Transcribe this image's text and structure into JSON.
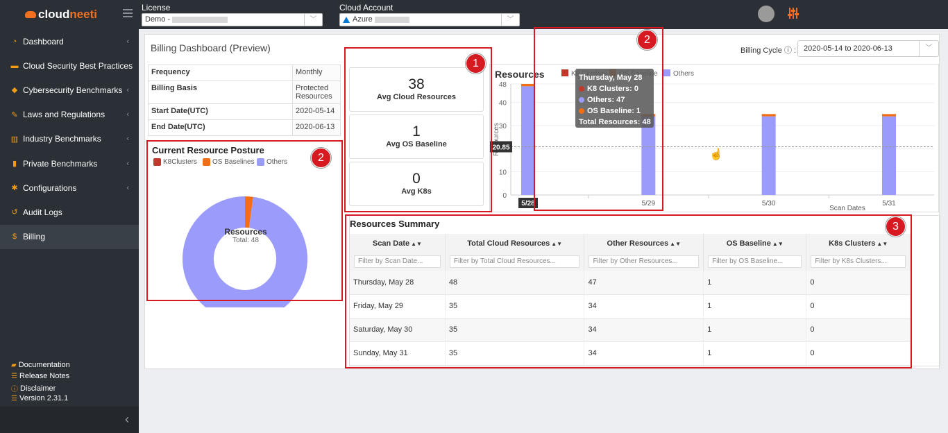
{
  "brand": {
    "part1": "cloud",
    "part2": "neeti"
  },
  "sidebar": {
    "items": [
      {
        "label": "Dashboard",
        "icon": "gauge-icon",
        "glyph": "◔",
        "chevron": true
      },
      {
        "label": "Cloud Security Best Practices",
        "icon": "briefcase-icon",
        "glyph": "▬",
        "chevron": false
      },
      {
        "label": "Cybersecurity Benchmarks",
        "icon": "shield-icon",
        "glyph": "◆",
        "chevron": true
      },
      {
        "label": "Laws and Regulations",
        "icon": "gavel-icon",
        "glyph": "✎",
        "chevron": true
      },
      {
        "label": "Industry Benchmarks",
        "icon": "bank-icon",
        "glyph": "▥",
        "chevron": true
      },
      {
        "label": "Private Benchmarks",
        "icon": "bar-chart-icon",
        "glyph": "▮",
        "chevron": true
      },
      {
        "label": "Configurations",
        "icon": "gear-icon",
        "glyph": "✱",
        "chevron": true
      },
      {
        "label": "Audit Logs",
        "icon": "history-icon",
        "glyph": "↺",
        "chevron": false
      },
      {
        "label": "Billing",
        "icon": "dollar-icon",
        "glyph": "$",
        "chevron": false
      }
    ],
    "footer": [
      {
        "label": "Documentation",
        "icon": "book-icon",
        "glyph": "▰"
      },
      {
        "label": "Release Notes",
        "icon": "list-icon",
        "glyph": "☰"
      },
      {
        "label": "Disclaimer",
        "icon": "info-icon",
        "glyph": "ⓘ"
      },
      {
        "label": "Version 2.31.1",
        "icon": "list-icon",
        "glyph": "☰"
      }
    ]
  },
  "topbar": {
    "license_label": "License",
    "license_value": "Demo -",
    "account_label": "Cloud Account",
    "account_value": "Azure"
  },
  "page": {
    "title": "Billing Dashboard (Preview)",
    "billing_cycle_label": "Billing Cycle",
    "billing_cycle_value": "2020-05-14 to 2020-06-13"
  },
  "info": [
    {
      "k": "Frequency",
      "v": "Monthly"
    },
    {
      "k": "Billing Basis",
      "v": "Protected Resources"
    },
    {
      "k": "Start Date(UTC)",
      "v": "2020-05-14"
    },
    {
      "k": "End Date(UTC)",
      "v": "2020-06-13"
    }
  ],
  "posture": {
    "title": "Current Resource Posture",
    "legend": [
      "K8Clusters",
      "OS Baselines",
      "Others"
    ],
    "center_title": "Resources",
    "center_sub": "Total: 48"
  },
  "stats": [
    {
      "value": "38",
      "label": "Avg Cloud Resources"
    },
    {
      "value": "1",
      "label": "Avg OS Baseline"
    },
    {
      "value": "0",
      "label": "Avg K8s"
    }
  ],
  "colors": {
    "k8": "#c0392b",
    "os": "#f36f16",
    "others": "#9b9bfb",
    "red": "#d71a21"
  },
  "chart_data": {
    "type": "bar",
    "title": "Resources",
    "stacked": true,
    "legend": [
      "K8 Clusters",
      "OS Baseline",
      "Others"
    ],
    "xlabel": "Scan Dates",
    "ylabel": "Resources",
    "categories": [
      "5/28",
      "5/29",
      "5/30",
      "5/31"
    ],
    "series": [
      {
        "name": "K8 Clusters",
        "values": [
          0,
          0,
          0,
          0
        ]
      },
      {
        "name": "OS Baseline",
        "values": [
          1,
          1,
          1,
          1
        ]
      },
      {
        "name": "Others",
        "values": [
          47,
          34,
          34,
          34
        ]
      }
    ],
    "yticks": [
      0,
      10,
      20,
      30,
      40,
      48
    ],
    "ylim": [
      0,
      48
    ],
    "average_line": 20.85,
    "average_label": "20.85",
    "tooltip": {
      "title": "Thursday, May 28",
      "lines": [
        "K8 Clusters: 0",
        "Others: 47",
        "OS Baseline: 1",
        "Total Resources: 48"
      ]
    }
  },
  "pie_data": {
    "k8": 0,
    "os": 1,
    "others": 47
  },
  "summary": {
    "title": "Resources Summary",
    "columns": [
      "Scan Date",
      "Total Cloud Resources",
      "Other Resources",
      "OS Baseline",
      "K8s Clusters"
    ],
    "filters": [
      "Filter by Scan Date...",
      "Filter by Total Cloud Resources...",
      "Filter by Other Resources...",
      "Filter by OS Baseline...",
      "Filter by K8s Clusters..."
    ],
    "rows": [
      [
        "Thursday, May 28",
        "48",
        "47",
        "1",
        "0"
      ],
      [
        "Friday, May 29",
        "35",
        "34",
        "1",
        "0"
      ],
      [
        "Saturday, May 30",
        "35",
        "34",
        "1",
        "0"
      ],
      [
        "Sunday, May 31",
        "35",
        "34",
        "1",
        "0"
      ]
    ]
  },
  "annotations": [
    "1",
    "2",
    "2",
    "3"
  ]
}
